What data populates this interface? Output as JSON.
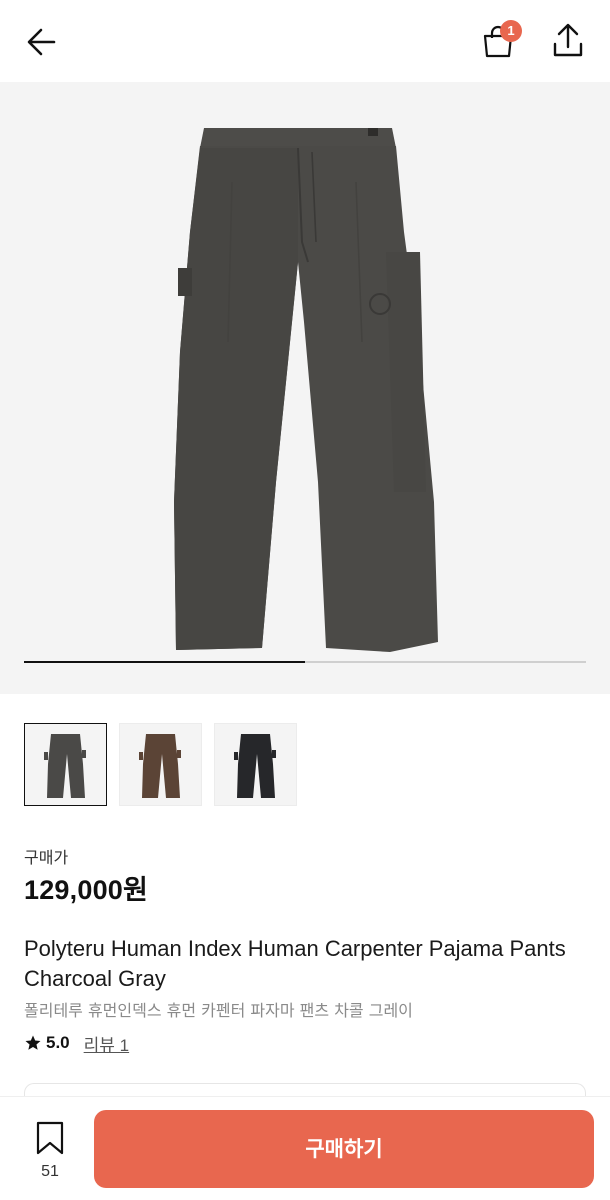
{
  "header": {
    "back_icon": "arrow-left-icon",
    "cart_icon": "shopping-bag-icon",
    "cart_count": "1",
    "share_icon": "share-upload-icon",
    "badge_color": "#e8674f"
  },
  "gallery": {
    "progress": 0.5,
    "thumbnails": [
      {
        "color_name": "charcoal",
        "color": "#4a4947",
        "selected": true
      },
      {
        "color_name": "brown",
        "color": "#5b4436",
        "selected": false
      },
      {
        "color_name": "black",
        "color": "#26272a",
        "selected": false
      }
    ]
  },
  "product": {
    "price_label": "구매가",
    "price": "129,000원",
    "title": "Polyteru Human Index Human Carpenter Pajama Pants Charcoal Gray",
    "subtitle": "폴리테루 휴먼인덱스 휴먼 카펜터 파자마 팬츠 차콜 그레이",
    "rating": "5.0",
    "review_link": "리뷰 1"
  },
  "bottom": {
    "bookmark_icon": "bookmark-icon",
    "wish_count": "51",
    "buy_label": "구매하기",
    "buy_color": "#e8674f"
  }
}
